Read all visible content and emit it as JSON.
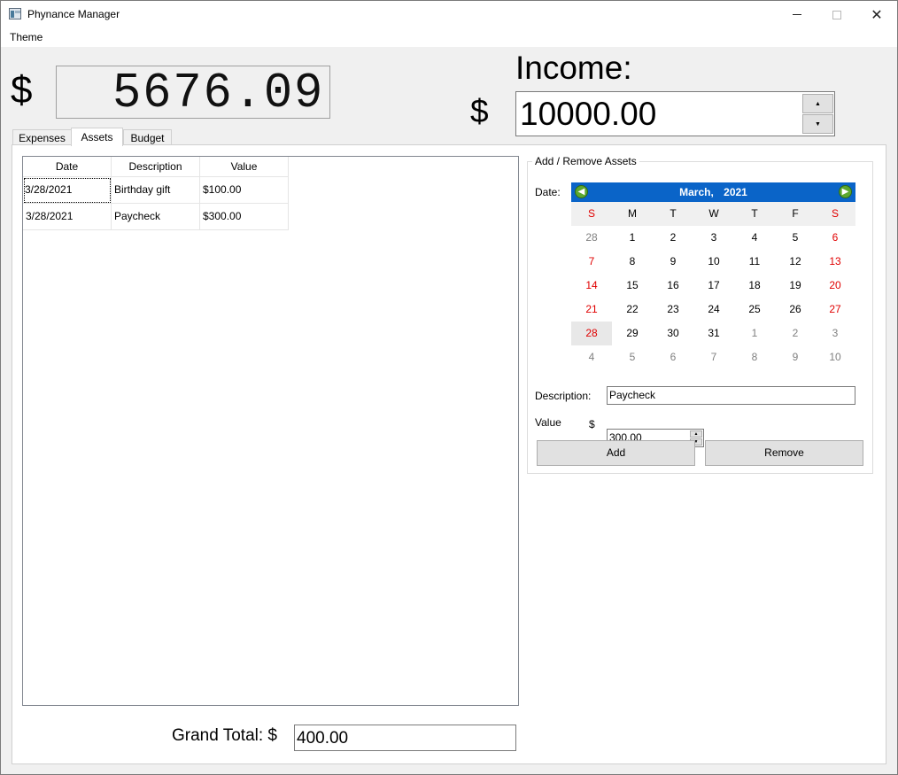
{
  "window": {
    "title": "Phynance Manager",
    "close_glyph": "✕"
  },
  "menu": {
    "theme": "Theme"
  },
  "balance": {
    "currency": "$",
    "display": "5676.09"
  },
  "income": {
    "label": "Income:",
    "currency": "$",
    "value": "10000.00",
    "up_glyph": "▲",
    "down_glyph": "▼"
  },
  "tabs": [
    {
      "label": "Expenses",
      "active": false
    },
    {
      "label": "Assets",
      "active": true
    },
    {
      "label": "Budget",
      "active": false
    }
  ],
  "assets_table": {
    "columns": [
      "Date",
      "Description",
      "Value"
    ],
    "rows": [
      {
        "date": "3/28/2021",
        "description": "Birthday gift",
        "value": "$100.00"
      },
      {
        "date": "3/28/2021",
        "description": "Paycheck",
        "value": "$300.00"
      }
    ]
  },
  "form": {
    "group_title": "Add / Remove Assets",
    "date_label": "Date:",
    "description_label": "Description:",
    "description_value": "Paycheck",
    "value_label": "Value",
    "currency": "$",
    "value_value": "300.00",
    "add_label": "Add",
    "remove_label": "Remove"
  },
  "calendar": {
    "month": "March,",
    "year": "2021",
    "prev_glyph": "◀",
    "next_glyph": "▶",
    "weekdays": [
      "S",
      "M",
      "T",
      "W",
      "T",
      "F",
      "S"
    ],
    "weeks": [
      [
        "28",
        "1",
        "2",
        "3",
        "4",
        "5",
        "6"
      ],
      [
        "7",
        "8",
        "9",
        "10",
        "11",
        "12",
        "13"
      ],
      [
        "14",
        "15",
        "16",
        "17",
        "18",
        "19",
        "20"
      ],
      [
        "21",
        "22",
        "23",
        "24",
        "25",
        "26",
        "27"
      ],
      [
        "28",
        "29",
        "30",
        "31",
        "1",
        "2",
        "3"
      ],
      [
        "4",
        "5",
        "6",
        "7",
        "8",
        "9",
        "10"
      ]
    ],
    "selected_day": "28",
    "weekend_color": "#e00000",
    "header_color": "#0a64c8"
  },
  "grand_total": {
    "label": "Grand Total: $",
    "value": "400.00"
  }
}
